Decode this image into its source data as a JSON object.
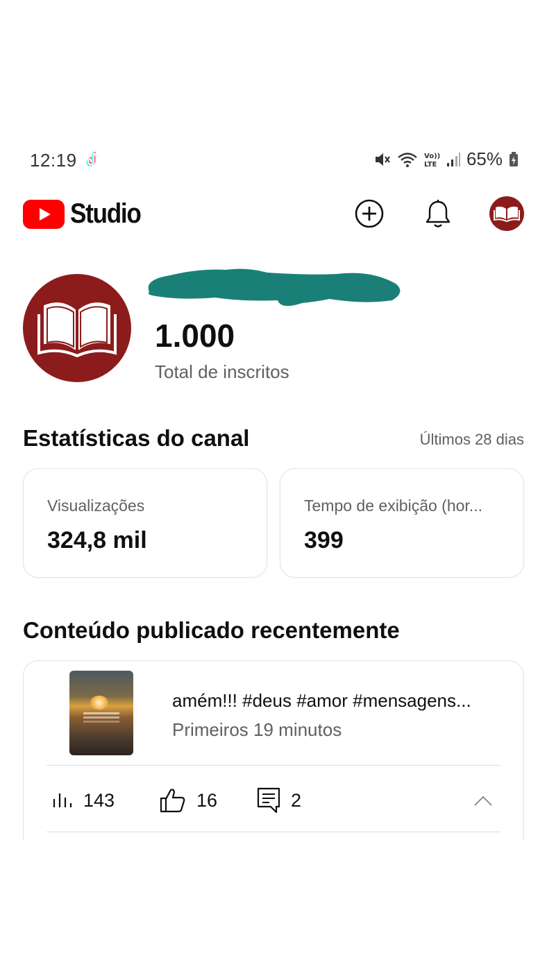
{
  "status_bar": {
    "time": "12:19",
    "battery": "65%",
    "icons": [
      "tiktok-icon",
      "mute-icon",
      "wifi-icon",
      "volte-icon",
      "signal-icon",
      "battery-icon"
    ]
  },
  "header": {
    "app_name": "Studio",
    "icons": [
      "youtube-logo-icon",
      "create-plus-icon",
      "bell-icon",
      "account-avatar-icon"
    ],
    "brand_color": "#ff0000"
  },
  "channel": {
    "subscriber_count": "1.000",
    "subscriber_label": "Total de inscritos",
    "avatar_color": "#8c1c1c",
    "redaction_color": "#1a8077"
  },
  "stats": {
    "title": "Estatísticas do canal",
    "period": "Últimos 28 dias",
    "cards": [
      {
        "label": "Visualizações",
        "value": "324,8 mil"
      },
      {
        "label": "Tempo de exibição (hor...",
        "value": "399"
      }
    ]
  },
  "recent": {
    "title": "Conteúdo publicado recentemente",
    "video": {
      "title": "amém!!! #deus #amor #mensagens...",
      "subtitle": "Primeiros 19 minutos",
      "views": "143",
      "likes": "16",
      "comments": "2"
    }
  }
}
